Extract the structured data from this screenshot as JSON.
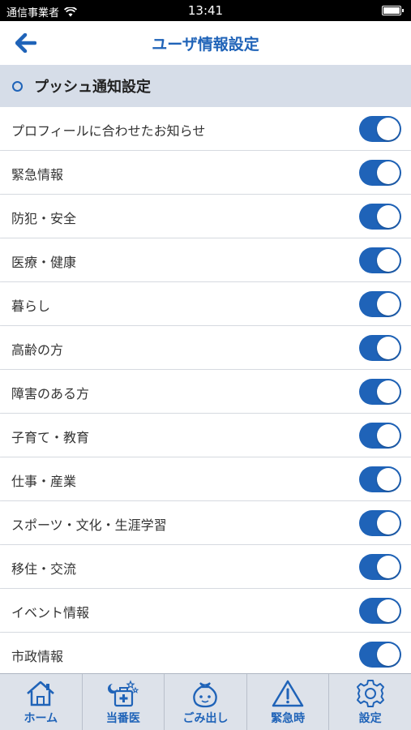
{
  "status_bar": {
    "carrier": "通信事業者",
    "time": "13:41"
  },
  "nav": {
    "title": "ユーザ情報設定",
    "back_icon": "back-arrow-icon"
  },
  "section": {
    "label": "プッシュ通知設定"
  },
  "settings": [
    {
      "label": "プロフィールに合わせたお知らせ",
      "on": true
    },
    {
      "label": "緊急情報",
      "on": true
    },
    {
      "label": "防犯・安全",
      "on": true
    },
    {
      "label": "医療・健康",
      "on": true
    },
    {
      "label": "暮らし",
      "on": true
    },
    {
      "label": "高齢の方",
      "on": true
    },
    {
      "label": "障害のある方",
      "on": true
    },
    {
      "label": "子育て・教育",
      "on": true
    },
    {
      "label": "仕事・産業",
      "on": true
    },
    {
      "label": "スポーツ・文化・生涯学習",
      "on": true
    },
    {
      "label": "移住・交流",
      "on": true
    },
    {
      "label": "イベント情報",
      "on": true
    },
    {
      "label": "市政情報",
      "on": true
    }
  ],
  "tabs": [
    {
      "label": "ホーム",
      "icon": "home-icon"
    },
    {
      "label": "当番医",
      "icon": "medical-bag-icon"
    },
    {
      "label": "ごみ出し",
      "icon": "trash-bag-icon"
    },
    {
      "label": "緊急時",
      "icon": "warning-icon"
    },
    {
      "label": "設定",
      "icon": "gear-icon"
    }
  ],
  "colors": {
    "accent": "#1f63b8",
    "section_bg": "#d6dde8",
    "tab_bg": "#dde2ea"
  }
}
